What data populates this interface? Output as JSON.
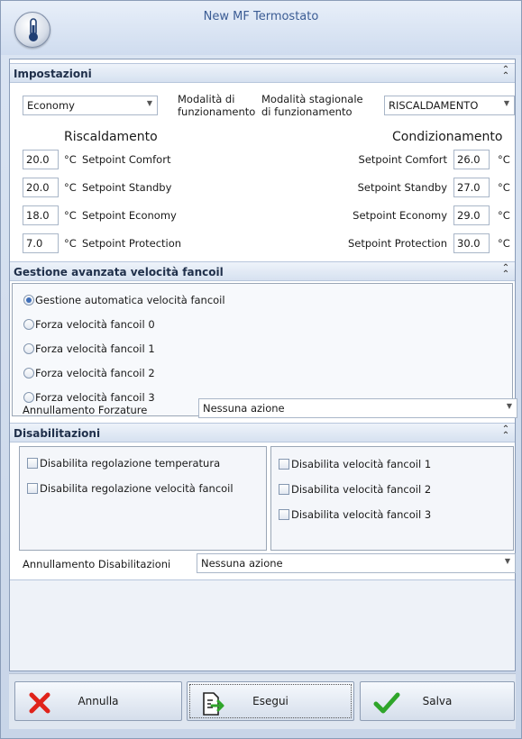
{
  "window": {
    "title": "New MF Termostato",
    "app_icon": "thermometer-icon"
  },
  "impostazioni": {
    "header": "Impostazioni",
    "mode_select": "Economy",
    "mode_label": "Modalità di funzionamento",
    "mode_label_line1": "Modalità di",
    "mode_label_line2": "funzionamento",
    "season_label_line1": "Modalità stagionale",
    "season_label_line2": "di funzionamento",
    "season_select": "RISCALDAMENTO",
    "heating_title": "Riscaldamento",
    "cooling_title": "Condizionamento",
    "unit": "°C",
    "heating": [
      {
        "value": "20.0",
        "label": "Setpoint Comfort"
      },
      {
        "value": "20.0",
        "label": "Setpoint Standby"
      },
      {
        "value": "18.0",
        "label": "Setpoint Economy"
      },
      {
        "value": "7.0",
        "label": "Setpoint Protection"
      }
    ],
    "cooling": [
      {
        "value": "26.0",
        "label": "Setpoint Comfort"
      },
      {
        "value": "27.0",
        "label": "Setpoint Standby"
      },
      {
        "value": "29.0",
        "label": "Setpoint Economy"
      },
      {
        "value": "30.0",
        "label": "Setpoint Protection"
      }
    ]
  },
  "fancoil": {
    "header": "Gestione avanzata velocità fancoil",
    "options": [
      "Gestione automatica velocità fancoil",
      "Forza velocità fancoil 0",
      "Forza velocità fancoil 1",
      "Forza velocità fancoil 2",
      "Forza velocità fancoil 3"
    ],
    "selected_index": 0,
    "override_label": "Annullamento Forzature",
    "override_select": "Nessuna azione"
  },
  "disabilitazioni": {
    "header": "Disabilitazioni",
    "left_checks": [
      "Disabilita regolazione temperatura",
      "Disabilita regolazione velocità fancoil"
    ],
    "right_checks": [
      "Disabilita velocità fancoil 1",
      "Disabilita velocità fancoil 2",
      "Disabilita velocità fancoil 3"
    ],
    "override_label": "Annullamento Disabilitazioni",
    "override_select": "Nessuna azione"
  },
  "buttons": {
    "cancel": "Annulla",
    "execute": "Esegui",
    "save": "Salva"
  },
  "colors": {
    "cancel_x": "#e0231b",
    "save_check": "#2fa52a",
    "title_text": "#3b5c94"
  }
}
